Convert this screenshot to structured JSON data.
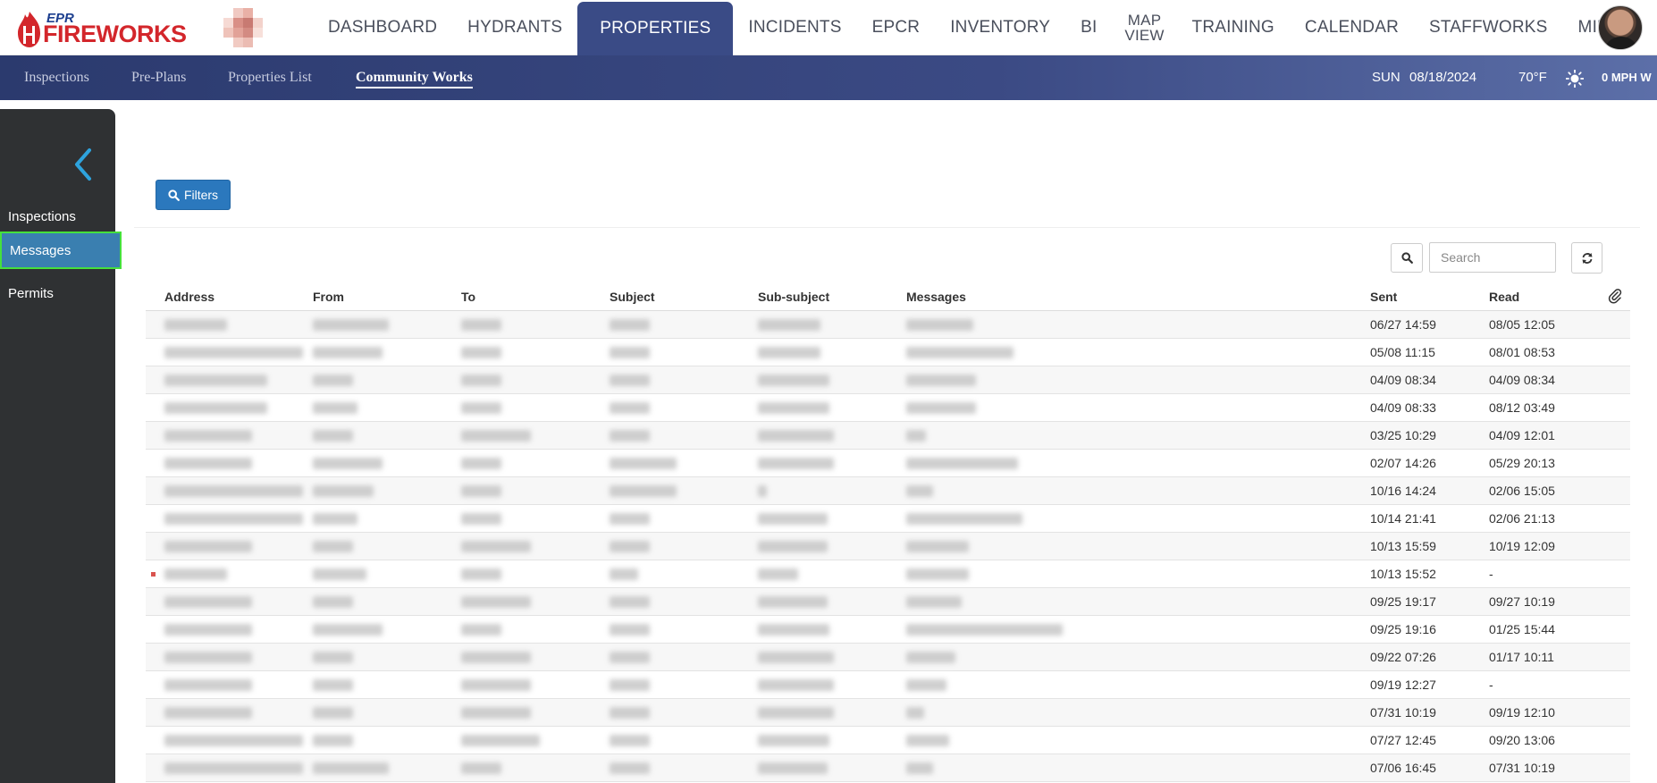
{
  "logo": {
    "small": "EPR",
    "brand": "FIREWORKS"
  },
  "nav": [
    {
      "label": "DASHBOARD",
      "active": false
    },
    {
      "label": "HYDRANTS",
      "active": false
    },
    {
      "label": "PROPERTIES",
      "active": true
    },
    {
      "label": "INCIDENTS",
      "active": false
    },
    {
      "label": "EPCR",
      "active": false
    },
    {
      "label": "INVENTORY",
      "active": false
    },
    {
      "label": "BI",
      "active": false
    },
    {
      "label": "MAP VIEW",
      "active": false
    },
    {
      "label": "TRAINING",
      "active": false
    },
    {
      "label": "CALENDAR",
      "active": false
    },
    {
      "label": "STAFFWORKS",
      "active": false
    },
    {
      "label": "MIH",
      "active": false
    }
  ],
  "subnav": [
    {
      "label": "Inspections"
    },
    {
      "label": "Pre-Plans"
    },
    {
      "label": "Properties List"
    },
    {
      "label": "Community Works",
      "active": true
    }
  ],
  "info": {
    "day": "SUN",
    "date": "08/18/2024",
    "temp": "70°F",
    "wind": "0 MPH W"
  },
  "sidebar": {
    "items": [
      {
        "label": "Inspections"
      },
      {
        "label": "Messages",
        "active": true
      },
      {
        "label": "Permits"
      }
    ]
  },
  "toolbar": {
    "filters_label": "Filters",
    "search_placeholder": "Search"
  },
  "table": {
    "columns": {
      "address": "Address",
      "from": "From",
      "to": "To",
      "subject": "Subject",
      "subsubject": "Sub-subject",
      "messages": "Messages",
      "sent": "Sent",
      "read": "Read"
    },
    "rows": [
      {
        "sent": "06/27 14:59",
        "read": "08/05 12:05"
      },
      {
        "sent": "05/08 11:15",
        "read": "08/01 08:53"
      },
      {
        "sent": "04/09 08:34",
        "read": "04/09 08:34"
      },
      {
        "sent": "04/09 08:33",
        "read": "08/12 03:49"
      },
      {
        "sent": "03/25 10:29",
        "read": "04/09 12:01"
      },
      {
        "sent": "02/07 14:26",
        "read": "05/29 20:13"
      },
      {
        "sent": "10/16 14:24",
        "read": "02/06 15:05"
      },
      {
        "sent": "10/14 21:41",
        "read": "02/06 21:13"
      },
      {
        "sent": "10/13 15:59",
        "read": "10/19 12:09"
      },
      {
        "sent": "10/13 15:52",
        "read": "-",
        "unread": true
      },
      {
        "sent": "09/25 19:17",
        "read": "09/27 10:19"
      },
      {
        "sent": "09/25 19:16",
        "read": "01/25 15:44"
      },
      {
        "sent": "09/22 07:26",
        "read": "01/17 10:11"
      },
      {
        "sent": "09/19 12:27",
        "read": "-"
      },
      {
        "sent": "07/31 10:19",
        "read": "09/19 12:10"
      },
      {
        "sent": "07/27 12:45",
        "read": "09/20 13:06"
      },
      {
        "sent": "07/06 16:45",
        "read": "07/31 10:19"
      }
    ]
  },
  "colors": {
    "nav_active": "#3a4b86",
    "accent": "#2b78bd",
    "sidebar": "#2f3133",
    "sidebar_active": "#3a7fb0",
    "highlight": "#46e03c"
  }
}
